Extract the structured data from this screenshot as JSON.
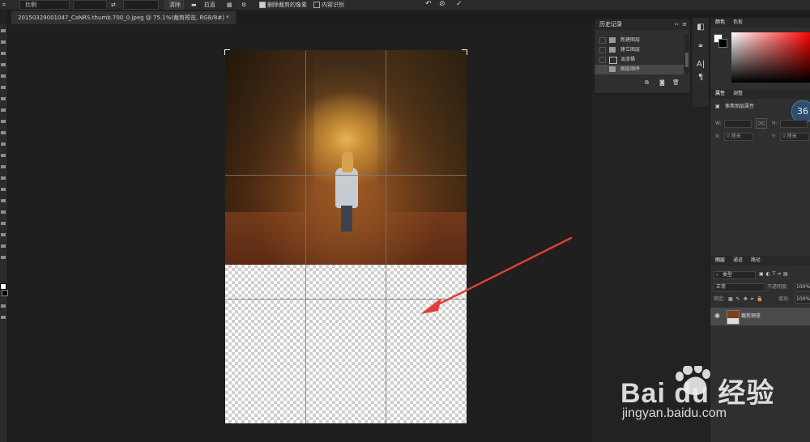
{
  "options_bar": {
    "ratio_label": "比例",
    "clear_label": "清除",
    "straighten_label": "拉直",
    "delete_cropped_label": "删除裁剪的像素",
    "content_aware_label": "内容识别"
  },
  "document_tab": {
    "title": "20150329001047_CaNRS.thumb.700_0.jpeg @ 75.1%(裁剪预览, RGB/8#) *"
  },
  "history_panel": {
    "title": "历史记录",
    "items": [
      {
        "label": "新建图层"
      },
      {
        "label": "建立图层"
      },
      {
        "label": "油漆桶"
      },
      {
        "label": "图层顺序"
      }
    ]
  },
  "color_panel": {
    "tabs": [
      "颜色",
      "色板"
    ]
  },
  "properties_panel": {
    "tabs": [
      "属性",
      "调整"
    ],
    "section_label": "像素图层属性",
    "w_label": "W:",
    "h_label": "H:",
    "x_label": "X:",
    "y_label": "Y:",
    "x_value": "0 厘米",
    "y_value": "0 厘米",
    "badge": "36"
  },
  "layers_panel": {
    "tabs": [
      "图层",
      "通道",
      "路径"
    ],
    "filter_label": "类型",
    "blend_mode": "正常",
    "opacity_label": "不透明度:",
    "opacity_value": "100%",
    "lock_label": "锁定:",
    "fill_label": "填充:",
    "fill_value": "100%",
    "layer_name": "裁剪预览"
  },
  "watermark": {
    "brand": "Bai du 经验",
    "url": "jingyan.baidu.com"
  },
  "colors": {
    "arrow": "#e23b3b",
    "accent": "#3a8ee6"
  }
}
